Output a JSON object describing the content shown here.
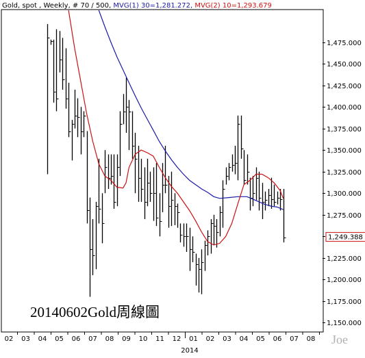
{
  "header": {
    "parts": [
      {
        "text": "Gold, spot , Weekly, # 70 / 500, ",
        "color": "#000000"
      },
      {
        "text": "MVG(1) 30=1,281.272, ",
        "color": "#1a1aa8"
      },
      {
        "text": "MVG(2) 10=1,293.679",
        "color": "#cc1111"
      }
    ]
  },
  "annotation": "20140602Gold周線圖",
  "watermark": "Joe",
  "year_label": "2014",
  "colors": {
    "background": "#ffffff",
    "bars": "#000000",
    "mvg30": "#1a1aa8",
    "mvg10": "#cc1111",
    "last_price_box": "#cc1111"
  },
  "chart_data": {
    "type": "ohlc",
    "title": "Gold, spot , Weekly, # 70 / 500",
    "ylim": [
      1140,
      1512
    ],
    "y_ticks": [
      1150,
      1175,
      1200,
      1225,
      1250,
      1275,
      1300,
      1325,
      1350,
      1375,
      1400,
      1425,
      1450,
      1475
    ],
    "y_tick_labels": [
      "1,150.000",
      "1,175.000",
      "1,200.000",
      "1,225.000",
      "1,250.000",
      "1,275.000",
      "1,300.000",
      "1,325.000",
      "1,350.000",
      "1,375.000",
      "1,400.000",
      "1,425.000",
      "1,450.000",
      "1,475.000"
    ],
    "x_month_labels": [
      "02",
      "03",
      "04",
      "05",
      "06",
      "07",
      "08",
      "09",
      "10",
      "11",
      "12",
      "01",
      "02",
      "03",
      "04",
      "05",
      "06",
      "07",
      "08"
    ],
    "xlim": [
      0,
      106
    ],
    "last_price": 1249.388,
    "last_price_label": "1,249.388",
    "grid": false,
    "bars": [
      {
        "x": 15,
        "high": 1496,
        "low": 1322,
        "close": 1480
      },
      {
        "x": 16,
        "high": 1478,
        "low": 1472,
        "close": 1476
      },
      {
        "x": 17,
        "high": 1478,
        "low": 1405,
        "close": 1418
      },
      {
        "x": 18,
        "high": 1490,
        "low": 1395,
        "close": 1410
      },
      {
        "x": 19,
        "high": 1488,
        "low": 1440,
        "close": 1455
      },
      {
        "x": 20,
        "high": 1480,
        "low": 1420,
        "close": 1432
      },
      {
        "x": 21,
        "high": 1468,
        "low": 1398,
        "close": 1410
      },
      {
        "x": 22,
        "high": 1428,
        "low": 1365,
        "close": 1372
      },
      {
        "x": 23,
        "high": 1385,
        "low": 1338,
        "close": 1380
      },
      {
        "x": 24,
        "high": 1420,
        "low": 1375,
        "close": 1390
      },
      {
        "x": 25,
        "high": 1410,
        "low": 1365,
        "close": 1388
      },
      {
        "x": 26,
        "high": 1400,
        "low": 1345,
        "close": 1372
      },
      {
        "x": 27,
        "high": 1395,
        "low": 1365,
        "close": 1390
      },
      {
        "x": 28,
        "high": 1372,
        "low": 1265,
        "close": 1280
      },
      {
        "x": 29,
        "high": 1295,
        "low": 1180,
        "close": 1235
      },
      {
        "x": 30,
        "high": 1270,
        "low": 1205,
        "close": 1228
      },
      {
        "x": 31,
        "high": 1290,
        "low": 1212,
        "close": 1285
      },
      {
        "x": 32,
        "high": 1340,
        "low": 1265,
        "close": 1282
      },
      {
        "x": 33,
        "high": 1300,
        "low": 1242,
        "close": 1265
      },
      {
        "x": 34,
        "high": 1350,
        "low": 1300,
        "close": 1330
      },
      {
        "x": 35,
        "high": 1345,
        "low": 1305,
        "close": 1318
      },
      {
        "x": 36,
        "high": 1345,
        "low": 1310,
        "close": 1320
      },
      {
        "x": 37,
        "high": 1345,
        "low": 1282,
        "close": 1290
      },
      {
        "x": 38,
        "high": 1345,
        "low": 1285,
        "close": 1330
      },
      {
        "x": 39,
        "high": 1395,
        "low": 1320,
        "close": 1380
      },
      {
        "x": 40,
        "high": 1415,
        "low": 1380,
        "close": 1395
      },
      {
        "x": 41,
        "high": 1434,
        "low": 1370,
        "close": 1400
      },
      {
        "x": 42,
        "high": 1408,
        "low": 1350,
        "close": 1395
      },
      {
        "x": 43,
        "high": 1395,
        "low": 1340,
        "close": 1355
      },
      {
        "x": 44,
        "high": 1370,
        "low": 1300,
        "close": 1340
      },
      {
        "x": 45,
        "high": 1355,
        "low": 1290,
        "close": 1318
      },
      {
        "x": 46,
        "high": 1340,
        "low": 1290,
        "close": 1305
      },
      {
        "x": 47,
        "high": 1330,
        "low": 1270,
        "close": 1290
      },
      {
        "x": 48,
        "high": 1340,
        "low": 1285,
        "close": 1312
      },
      {
        "x": 49,
        "high": 1325,
        "low": 1290,
        "close": 1300
      },
      {
        "x": 50,
        "high": 1330,
        "low": 1268,
        "close": 1300
      },
      {
        "x": 51,
        "high": 1335,
        "low": 1262,
        "close": 1272
      },
      {
        "x": 52,
        "high": 1300,
        "low": 1250,
        "close": 1268
      },
      {
        "x": 53,
        "high": 1335,
        "low": 1278,
        "close": 1310
      },
      {
        "x": 54,
        "high": 1355,
        "low": 1300,
        "close": 1310
      },
      {
        "x": 55,
        "high": 1320,
        "low": 1260,
        "close": 1285
      },
      {
        "x": 56,
        "high": 1325,
        "low": 1262,
        "close": 1292
      },
      {
        "x": 57,
        "high": 1300,
        "low": 1263,
        "close": 1285
      },
      {
        "x": 58,
        "high": 1288,
        "low": 1260,
        "close": 1278
      },
      {
        "x": 59,
        "high": 1265,
        "low": 1243,
        "close": 1252
      },
      {
        "x": 60,
        "high": 1265,
        "low": 1238,
        "close": 1250
      },
      {
        "x": 61,
        "high": 1265,
        "low": 1232,
        "close": 1250
      },
      {
        "x": 62,
        "high": 1260,
        "low": 1210,
        "close": 1235
      },
      {
        "x": 63,
        "high": 1250,
        "low": 1220,
        "close": 1232
      },
      {
        "x": 64,
        "high": 1230,
        "low": 1193,
        "close": 1218
      },
      {
        "x": 65,
        "high": 1225,
        "low": 1185,
        "close": 1212
      },
      {
        "x": 66,
        "high": 1235,
        "low": 1183,
        "close": 1220
      },
      {
        "x": 67,
        "high": 1245,
        "low": 1210,
        "close": 1240
      },
      {
        "x": 68,
        "high": 1257,
        "low": 1228,
        "close": 1250
      },
      {
        "x": 69,
        "high": 1270,
        "low": 1230,
        "close": 1265
      },
      {
        "x": 70,
        "high": 1275,
        "low": 1240,
        "close": 1262
      },
      {
        "x": 71,
        "high": 1270,
        "low": 1237,
        "close": 1255
      },
      {
        "x": 72,
        "high": 1285,
        "low": 1250,
        "close": 1278
      },
      {
        "x": 73,
        "high": 1315,
        "low": 1260,
        "close": 1305
      },
      {
        "x": 74,
        "high": 1330,
        "low": 1310,
        "close": 1320
      },
      {
        "x": 75,
        "high": 1335,
        "low": 1315,
        "close": 1330
      },
      {
        "x": 76,
        "high": 1345,
        "low": 1325,
        "close": 1333
      },
      {
        "x": 77,
        "high": 1355,
        "low": 1322,
        "close": 1335
      },
      {
        "x": 78,
        "high": 1390,
        "low": 1315,
        "close": 1380
      },
      {
        "x": 79,
        "high": 1390,
        "low": 1340,
        "close": 1352
      },
      {
        "x": 80,
        "high": 1350,
        "low": 1310,
        "close": 1315
      },
      {
        "x": 81,
        "high": 1345,
        "low": 1310,
        "close": 1325
      },
      {
        "x": 82,
        "high": 1318,
        "low": 1280,
        "close": 1295
      },
      {
        "x": 83,
        "high": 1320,
        "low": 1285,
        "close": 1300
      },
      {
        "x": 84,
        "high": 1330,
        "low": 1292,
        "close": 1318
      },
      {
        "x": 85,
        "high": 1325,
        "low": 1280,
        "close": 1295
      },
      {
        "x": 86,
        "high": 1312,
        "low": 1270,
        "close": 1290
      },
      {
        "x": 87,
        "high": 1302,
        "low": 1280,
        "close": 1292
      },
      {
        "x": 88,
        "high": 1305,
        "low": 1285,
        "close": 1298
      },
      {
        "x": 89,
        "high": 1318,
        "low": 1282,
        "close": 1293
      },
      {
        "x": 90,
        "high": 1310,
        "low": 1285,
        "close": 1290
      },
      {
        "x": 91,
        "high": 1302,
        "low": 1287,
        "close": 1295
      },
      {
        "x": 92,
        "high": 1305,
        "low": 1280,
        "close": 1293
      },
      {
        "x": 93,
        "high": 1305,
        "low": 1243,
        "close": 1249
      }
    ],
    "series": [
      {
        "name": "MVG(1) 30",
        "color": "#1a1aa8",
        "value": 1281.272,
        "points": [
          [
            32,
            1512
          ],
          [
            34,
            1493
          ],
          [
            36,
            1475
          ],
          [
            38,
            1458
          ],
          [
            40,
            1443
          ],
          [
            42,
            1428
          ],
          [
            44,
            1413
          ],
          [
            46,
            1399
          ],
          [
            48,
            1386
          ],
          [
            50,
            1373
          ],
          [
            52,
            1360
          ],
          [
            54,
            1349
          ],
          [
            56,
            1339
          ],
          [
            58,
            1330
          ],
          [
            60,
            1322
          ],
          [
            62,
            1315
          ],
          [
            64,
            1310
          ],
          [
            66,
            1305
          ],
          [
            68,
            1301
          ],
          [
            70,
            1296
          ],
          [
            72,
            1294
          ],
          [
            75,
            1295
          ],
          [
            78,
            1296
          ],
          [
            81,
            1296
          ],
          [
            83,
            1293
          ],
          [
            85,
            1290
          ],
          [
            87,
            1287
          ],
          [
            89,
            1285
          ],
          [
            91,
            1284
          ],
          [
            93,
            1281
          ]
        ]
      },
      {
        "name": "MVG(2) 10",
        "color": "#cc1111",
        "value": 1293.679,
        "points": [
          [
            22,
            1512
          ],
          [
            24,
            1468
          ],
          [
            26,
            1430
          ],
          [
            28,
            1392
          ],
          [
            30,
            1360
          ],
          [
            32,
            1334
          ],
          [
            34,
            1320
          ],
          [
            36,
            1315
          ],
          [
            38,
            1307
          ],
          [
            40,
            1306
          ],
          [
            41,
            1312
          ],
          [
            42,
            1330
          ],
          [
            44,
            1345
          ],
          [
            46,
            1350
          ],
          [
            48,
            1347
          ],
          [
            50,
            1343
          ],
          [
            52,
            1330
          ],
          [
            54,
            1318
          ],
          [
            56,
            1308
          ],
          [
            58,
            1300
          ],
          [
            60,
            1290
          ],
          [
            62,
            1280
          ],
          [
            64,
            1268
          ],
          [
            66,
            1255
          ],
          [
            68,
            1244
          ],
          [
            70,
            1240
          ],
          [
            72,
            1242
          ],
          [
            74,
            1250
          ],
          [
            76,
            1265
          ],
          [
            78,
            1288
          ],
          [
            80,
            1310
          ],
          [
            82,
            1315
          ],
          [
            84,
            1322
          ],
          [
            86,
            1322
          ],
          [
            88,
            1318
          ],
          [
            90,
            1312
          ],
          [
            92,
            1303
          ],
          [
            93,
            1294
          ]
        ]
      }
    ]
  }
}
